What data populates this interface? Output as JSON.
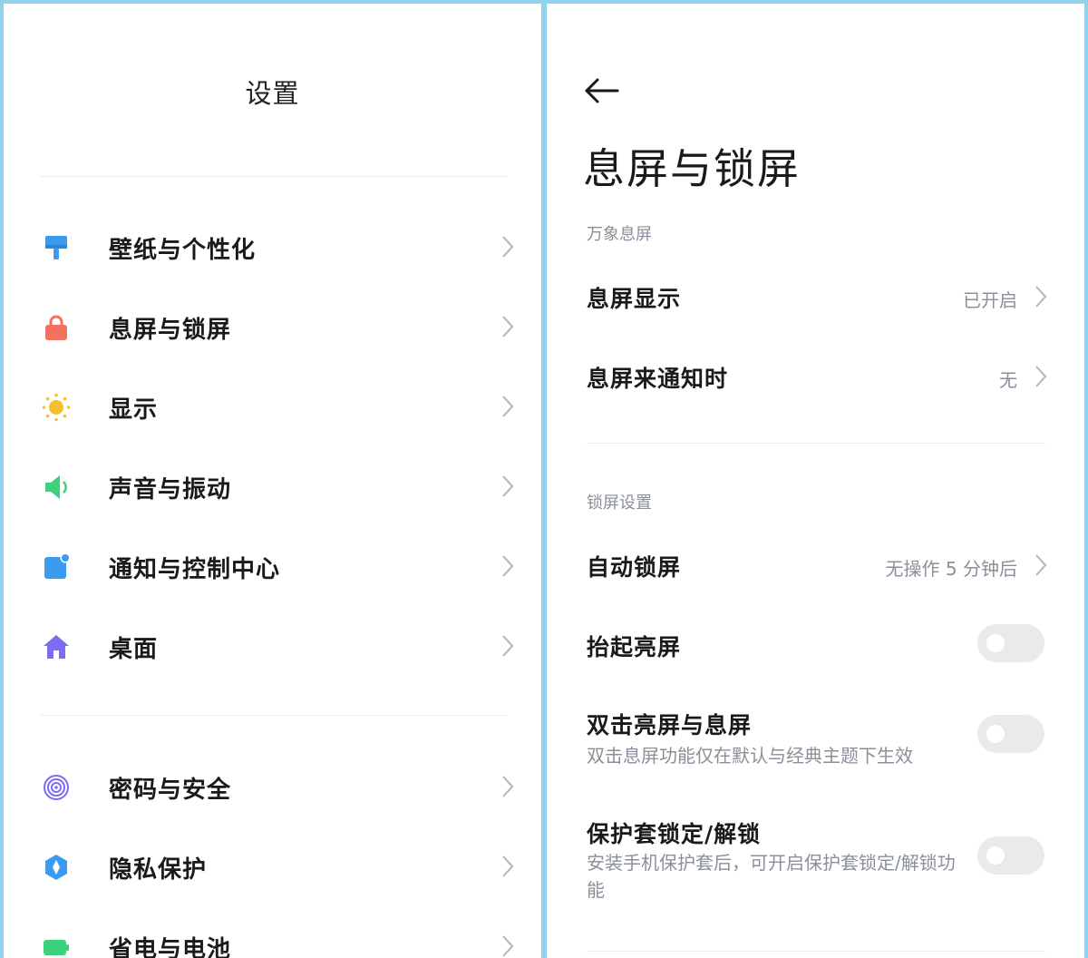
{
  "left": {
    "title": "设置",
    "menu_group_1": [
      {
        "label": "壁纸与个性化",
        "icon": "paint-roller-icon"
      },
      {
        "label": "息屏与锁屏",
        "icon": "lock-icon"
      },
      {
        "label": "显示",
        "icon": "sun-icon"
      },
      {
        "label": "声音与振动",
        "icon": "speaker-icon"
      },
      {
        "label": "通知与控制中心",
        "icon": "notification-icon"
      },
      {
        "label": "桌面",
        "icon": "home-icon"
      }
    ],
    "menu_group_2": [
      {
        "label": "密码与安全",
        "icon": "fingerprint-icon"
      },
      {
        "label": "隐私保护",
        "icon": "privacy-shield-icon"
      },
      {
        "label": "省电与电池",
        "icon": "battery-icon"
      }
    ]
  },
  "right": {
    "title": "息屏与锁屏",
    "section_aod": {
      "header": "万象息屏",
      "items": [
        {
          "label": "息屏显示",
          "value": "已开启"
        },
        {
          "label": "息屏来通知时",
          "value": "无"
        }
      ]
    },
    "section_lock": {
      "header": "锁屏设置",
      "auto_lock": {
        "label": "自动锁屏",
        "value": "无操作 5 分钟后"
      },
      "raise_to_wake": {
        "label": "抬起亮屏",
        "on": false
      },
      "double_tap": {
        "label": "双击亮屏与息屏",
        "desc": "双击息屏功能仅在默认与经典主题下生效",
        "on": false
      },
      "cover_lock": {
        "label": "保护套锁定/解锁",
        "desc": "安装手机保护套后，可开启保护套锁定/解锁功能",
        "on": false
      }
    }
  },
  "colors": {
    "frame": "#8fd2ee",
    "wallpaper_icon": "#3a9bf0",
    "lock_icon": "#f3715f",
    "sun_icon": "#f7c02a",
    "sound_icon": "#3cd17c",
    "notification_icon": "#3a9bf0",
    "home_icon": "#7b6cf0",
    "security_icon": "#7b6cf0",
    "privacy_icon": "#3a9bf0",
    "battery_icon": "#3cd17c",
    "toggle_off": "#eaeaea"
  }
}
